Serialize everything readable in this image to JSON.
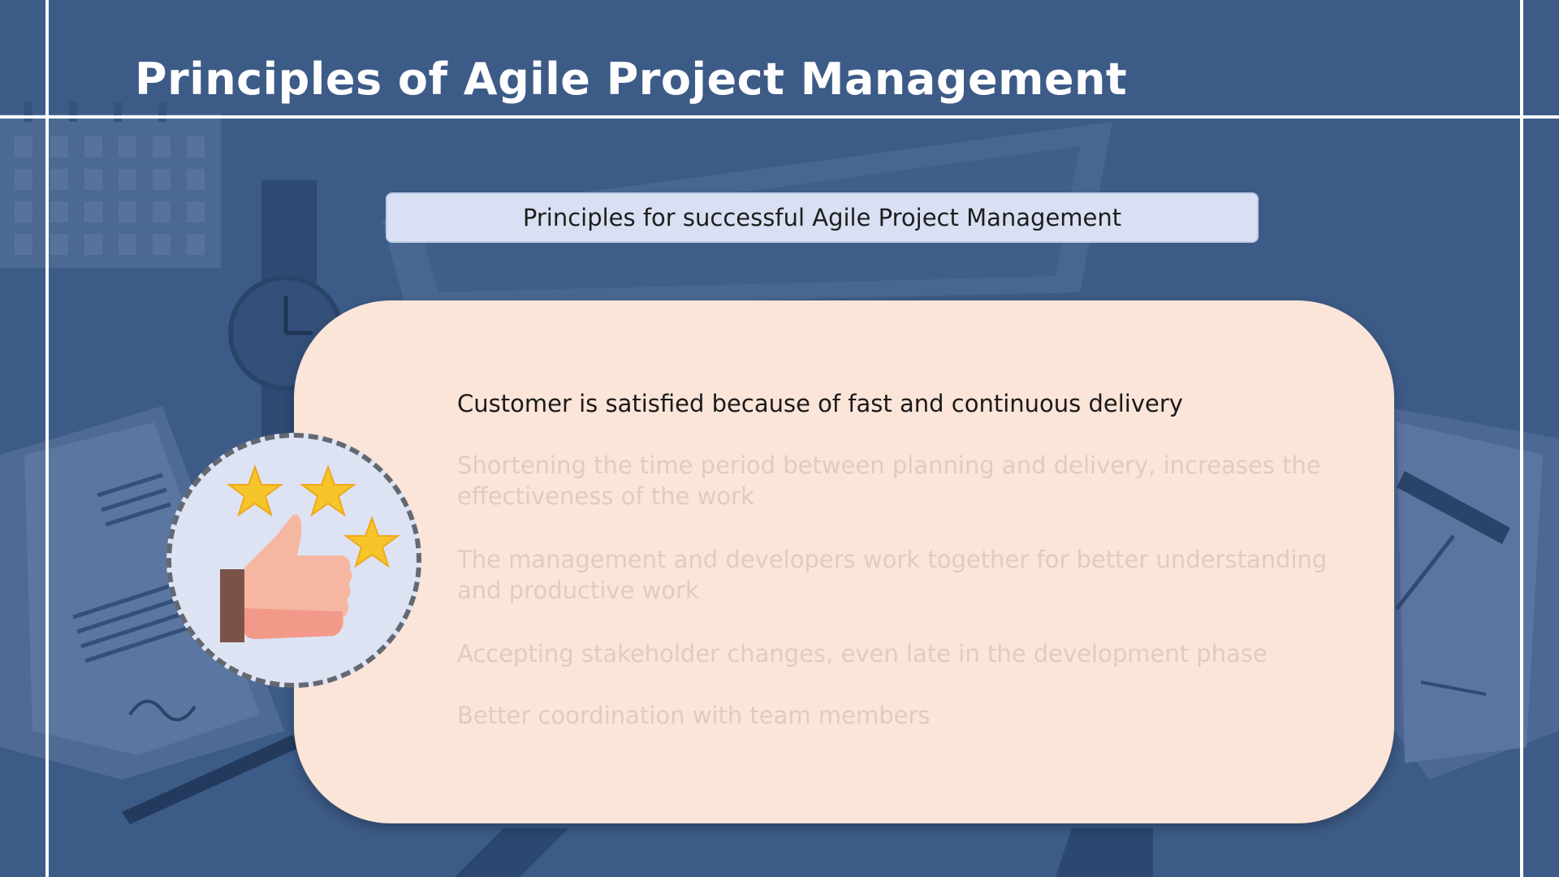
{
  "slide": {
    "title": "Principles of Agile Project Management",
    "subtitle": "Principles for successful Agile Project Management",
    "principles": [
      {
        "text": "Customer is satisfied because of fast and continuous delivery",
        "state": "highlighted"
      },
      {
        "text": "Shortening the time period between planning and delivery, increases the effectiveness of the work",
        "state": "dimmed"
      },
      {
        "text": "The management and developers work together for better understanding and productive work",
        "state": "dimmed"
      },
      {
        "text": "Accepting stakeholder changes, even late in the development phase",
        "state": "dimmed"
      },
      {
        "text": "Better coordination with team members",
        "state": "dimmed"
      }
    ],
    "badge_icon": "thumbs-up-with-stars-icon"
  },
  "colors": {
    "background": "#3d5b87",
    "card": "#fbe4d8",
    "subtitle_box": "#d9e0f3",
    "active_text": "#1a1a1a",
    "dimmed_text": "#e1cbbf"
  }
}
